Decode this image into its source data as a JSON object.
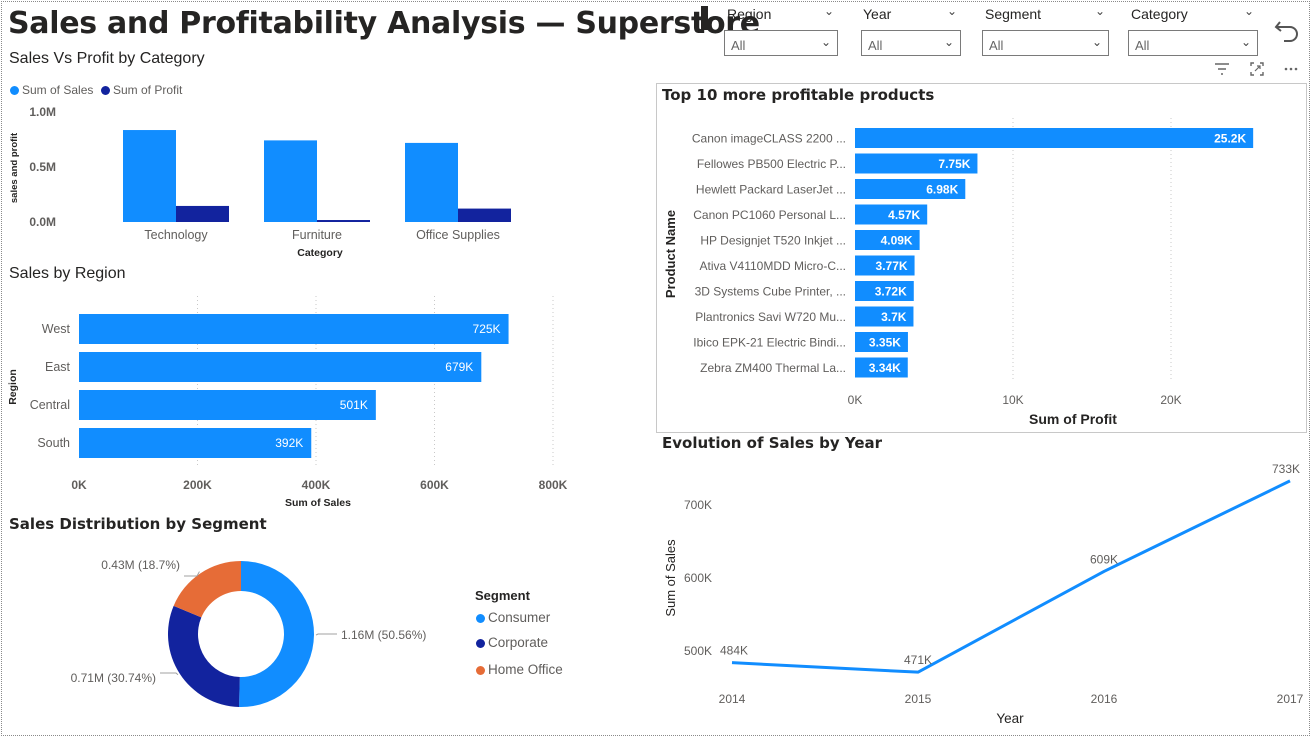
{
  "header": {
    "title": "Sales and Profitability Analysis — Superstore"
  },
  "slicers": [
    {
      "label": "Region",
      "value": "All"
    },
    {
      "label": "Year",
      "value": "All"
    },
    {
      "label": "Segment",
      "value": "All"
    },
    {
      "label": "Category",
      "value": "All"
    }
  ],
  "icons": {
    "undo": "undo-icon",
    "filter": "filter-icon",
    "focus": "focus-mode-icon",
    "more": "more-options-icon"
  },
  "colors": {
    "sales": "#118dff",
    "profit": "#12239e",
    "home_office": "#e66c37",
    "line": "#118dff"
  },
  "chart_data": [
    {
      "id": "sales_vs_profit",
      "type": "bar",
      "title": "Sales Vs Profit by Category",
      "xlabel": "Category",
      "ylabel": "sales and profit",
      "categories": [
        "Technology",
        "Furniture",
        "Office Supplies"
      ],
      "series": [
        {
          "name": "Sum of Sales",
          "values": [
            836000,
            742000,
            719000
          ]
        },
        {
          "name": "Sum of Profit",
          "values": [
            146000,
            18000,
            122000
          ]
        }
      ],
      "yticks": [
        "0.0M",
        "0.5M",
        "1.0M"
      ],
      "ylim": [
        0,
        1000000
      ],
      "legend": "top-left"
    },
    {
      "id": "sales_by_region",
      "type": "bar",
      "orientation": "horizontal",
      "title": "Sales by Region",
      "xlabel": "Sum of Sales",
      "ylabel": "Region",
      "categories": [
        "West",
        "East",
        "Central",
        "South"
      ],
      "values": [
        725000,
        679000,
        501000,
        392000
      ],
      "labels": [
        "725K",
        "679K",
        "501K",
        "392K"
      ],
      "xticks": [
        "0K",
        "200K",
        "400K",
        "600K",
        "800K"
      ],
      "xlim": [
        0,
        800000
      ]
    },
    {
      "id": "sales_by_segment",
      "type": "pie",
      "donut": true,
      "title": "Sales Distribution by Segment",
      "legend_title": "Segment",
      "slices": [
        {
          "name": "Consumer",
          "value": 1.16,
          "label": "1.16M (50.56%)"
        },
        {
          "name": "Corporate",
          "value": 0.71,
          "label": "0.71M (30.74%)"
        },
        {
          "name": "Home Office",
          "value": 0.43,
          "label": "0.43M (18.7%)"
        }
      ],
      "legend": "right"
    },
    {
      "id": "top10_products",
      "type": "bar",
      "orientation": "horizontal",
      "title": "Top 10 more profitable products",
      "xlabel": "Sum of Profit",
      "ylabel": "Product Name",
      "categories": [
        "Canon imageCLASS 2200 ...",
        "Fellowes PB500 Electric P...",
        "Hewlett Packard LaserJet ...",
        "Canon PC1060 Personal L...",
        "HP Designjet T520 Inkjet ...",
        "Ativa V4110MDD Micro-C...",
        "3D Systems Cube Printer, ...",
        "Plantronics Savi W720 Mu...",
        "Ibico EPK-21 Electric Bindi...",
        "Zebra ZM400 Thermal La..."
      ],
      "values": [
        25200,
        7750,
        6980,
        4570,
        4090,
        3770,
        3720,
        3700,
        3350,
        3340
      ],
      "labels": [
        "25.2K",
        "7.75K",
        "6.98K",
        "4.57K",
        "4.09K",
        "3.77K",
        "3.72K",
        "3.7K",
        "3.35K",
        "3.34K"
      ],
      "xticks": [
        "0K",
        "10K",
        "20K"
      ],
      "xlim": [
        0,
        27000
      ]
    },
    {
      "id": "sales_by_year",
      "type": "line",
      "title": "Evolution of Sales by Year",
      "xlabel": "Year",
      "ylabel": "Sum of Sales",
      "x": [
        "2014",
        "2015",
        "2016",
        "2017"
      ],
      "values": [
        484000,
        471000,
        609000,
        733000
      ],
      "labels": [
        "484K",
        "471K",
        "609K",
        "733K"
      ],
      "yticks": [
        "500K",
        "600K",
        "700K"
      ],
      "ylim": [
        460000,
        745000
      ]
    }
  ]
}
